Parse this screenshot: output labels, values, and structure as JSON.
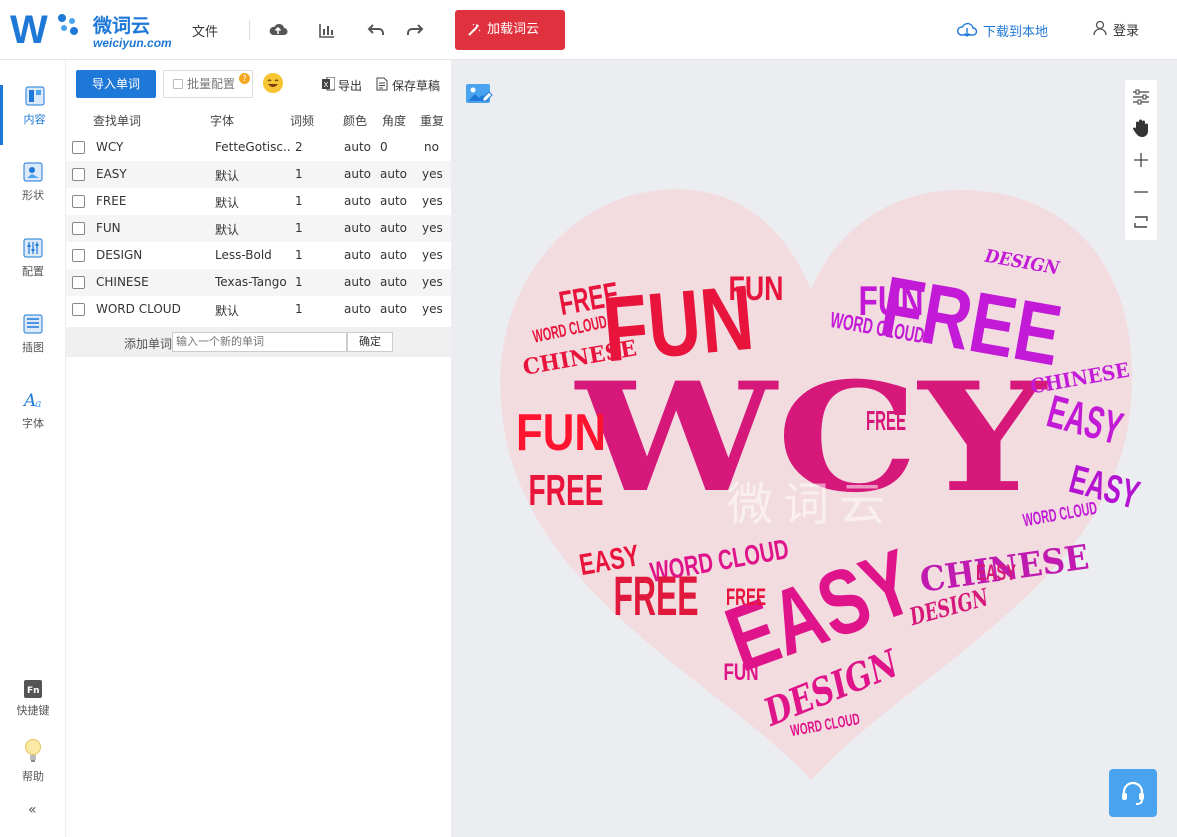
{
  "app": {
    "logo_cn": "微词云",
    "logo_en": "weiciyun.com",
    "menu_file": "文件",
    "load_cloud": "加载词云",
    "download_local": "下载到本地",
    "login": "登录"
  },
  "sidebar": {
    "items": [
      {
        "label": "内容",
        "icon": "content-icon"
      },
      {
        "label": "形状",
        "icon": "shape-icon"
      },
      {
        "label": "配置",
        "icon": "settings-icon"
      },
      {
        "label": "插图",
        "icon": "illustration-icon"
      },
      {
        "label": "字体",
        "icon": "font-icon"
      }
    ],
    "shortcut_label": "快捷键",
    "help_label": "帮助",
    "collapse_symbol": "«"
  },
  "panel": {
    "import_words": "导入单词",
    "batch_config": "批量配置",
    "batch_badge": "?",
    "export": "导出",
    "save_draft": "保存草稿",
    "columns": {
      "word": "查找单词",
      "font": "字体",
      "freq": "词频",
      "color": "颜色",
      "angle": "角度",
      "repeat": "重复"
    },
    "rows": [
      {
        "word": "WCY",
        "font": "FetteGotisc...",
        "freq": "2",
        "color": "auto",
        "angle": "0",
        "repeat": "no"
      },
      {
        "word": "EASY",
        "font": "默认",
        "freq": "1",
        "color": "auto",
        "angle": "auto",
        "repeat": "yes"
      },
      {
        "word": "FREE",
        "font": "默认",
        "freq": "1",
        "color": "auto",
        "angle": "auto",
        "repeat": "yes"
      },
      {
        "word": "FUN",
        "font": "默认",
        "freq": "1",
        "color": "auto",
        "angle": "auto",
        "repeat": "yes"
      },
      {
        "word": "DESIGN",
        "font": "Less-Bold",
        "freq": "1",
        "color": "auto",
        "angle": "auto",
        "repeat": "yes"
      },
      {
        "word": "CHINESE",
        "font": "Texas-Tango",
        "freq": "1",
        "color": "auto",
        "angle": "auto",
        "repeat": "yes"
      },
      {
        "word": "WORD CLOUD",
        "font": "默认",
        "freq": "1",
        "color": "auto",
        "angle": "auto",
        "repeat": "yes"
      }
    ],
    "add_word_label": "添加单词",
    "add_word_placeholder": "输入一个新的单词",
    "confirm": "确定"
  },
  "canvas": {
    "watermark": "微词云",
    "cloud_words": {
      "wcy": "WCY",
      "fun": "FUN",
      "free": "FREE",
      "easy": "EASY",
      "design": "DESIGN",
      "chinese": "CHINESE",
      "word_cloud": "WORD CLOUD"
    },
    "colors": {
      "red": "#e8143c",
      "pink": "#e0148a",
      "magenta": "#b414d2",
      "heart": "#f2dce0"
    }
  }
}
